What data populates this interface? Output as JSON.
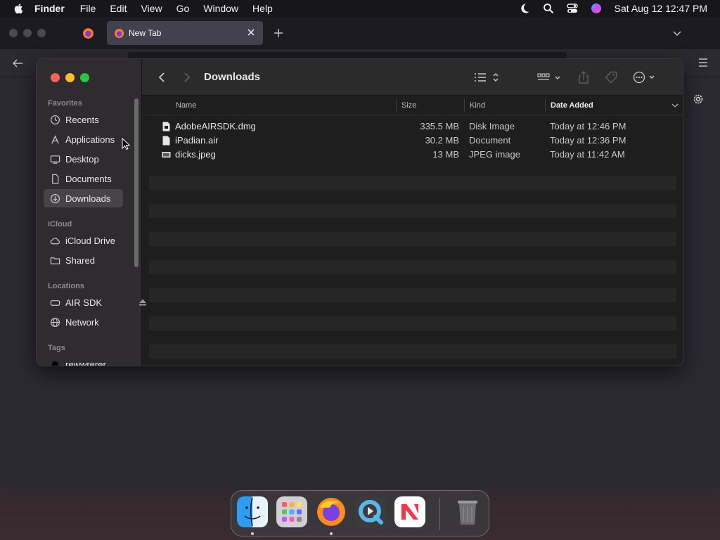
{
  "menubar": {
    "app_name": "Finder",
    "menus": [
      "File",
      "Edit",
      "View",
      "Go",
      "Window",
      "Help"
    ],
    "clock": "Sat Aug 12  12:47 PM",
    "status_icons": [
      "moon-icon",
      "search-icon",
      "control-center-icon",
      "siri-icon"
    ]
  },
  "browser": {
    "tab_title": "New Tab"
  },
  "finder": {
    "title": "Downloads",
    "sidebar": {
      "favorites_label": "Favorites",
      "favorites": [
        {
          "label": "Recents",
          "icon": "clock-icon"
        },
        {
          "label": "Applications",
          "icon": "applications-icon"
        },
        {
          "label": "Desktop",
          "icon": "desktop-icon"
        },
        {
          "label": "Documents",
          "icon": "document-icon"
        },
        {
          "label": "Downloads",
          "icon": "download-icon",
          "selected": true
        }
      ],
      "icloud_label": "iCloud",
      "icloud": [
        {
          "label": "iCloud Drive",
          "icon": "cloud-icon"
        },
        {
          "label": "Shared",
          "icon": "shared-folder-icon"
        }
      ],
      "locations_label": "Locations",
      "locations": [
        {
          "label": "AIR SDK",
          "icon": "drive-icon"
        },
        {
          "label": "Network",
          "icon": "globe-icon"
        }
      ],
      "tags_label": "Tags",
      "tags": [
        {
          "label": "rewwrerer",
          "color": "#000000"
        }
      ]
    },
    "columns": {
      "name": "Name",
      "size": "Size",
      "kind": "Kind",
      "date_added": "Date Added"
    },
    "files": [
      {
        "name": "AdobeAIRSDK.dmg",
        "size": "335.5 MB",
        "kind": "Disk Image",
        "date": "Today at 12:46 PM"
      },
      {
        "name": "iPadian.air",
        "size": "30.2 MB",
        "kind": "Document",
        "date": "Today at 12:36 PM"
      },
      {
        "name": "dicks.jpeg",
        "size": "13 MB",
        "kind": "JPEG image",
        "date": "Today at 11:42 AM"
      }
    ]
  },
  "dock": {
    "apps": [
      "Finder",
      "Launchpad",
      "Firefox",
      "QuickTime Player",
      "News",
      "Trash"
    ]
  },
  "colors": {
    "traffic_red": "#fe5f57",
    "traffic_yellow": "#febc2e",
    "traffic_green": "#28c840",
    "selection": "#464446"
  }
}
